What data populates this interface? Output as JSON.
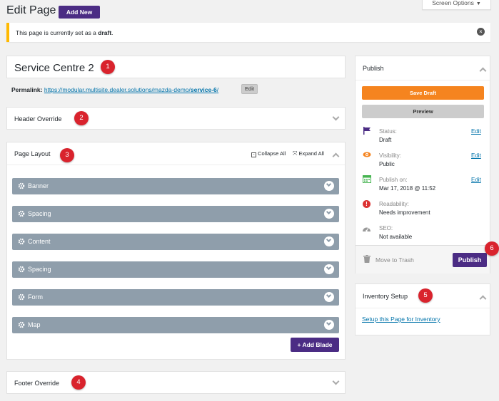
{
  "header": {
    "title": "Edit Page",
    "add_new": "Add New",
    "screen_options": "Screen Options"
  },
  "notice": {
    "text_prefix": "This page is currently set as a ",
    "status": "draft",
    "text_suffix": "."
  },
  "post": {
    "title": "Service Centre 2",
    "permalink_label": "Permalink:",
    "permalink_base": "https://modular.multisite.dealer.solutions/mazda-demo/",
    "permalink_slug": "service-6",
    "permalink_trail": "/",
    "permalink_edit": "Edit"
  },
  "panels": {
    "header_override": "Header Override",
    "page_layout": "Page Layout",
    "collapse_all": "Collapse All",
    "expand_all": "Expand All",
    "footer_override": "Footer Override"
  },
  "blades": [
    {
      "label": "Banner"
    },
    {
      "label": "Spacing"
    },
    {
      "label": "Content"
    },
    {
      "label": "Spacing"
    },
    {
      "label": "Form"
    },
    {
      "label": "Map"
    }
  ],
  "add_blade": "+ Add Blade",
  "publish": {
    "title": "Publish",
    "save_draft": "Save Draft",
    "preview": "Preview",
    "status_label": "Status:",
    "status_value": "Draft",
    "visibility_label": "Visibility:",
    "visibility_value": "Public",
    "publish_on_label": "Publish on:",
    "publish_on_value": "Mar 17, 2018 @ 11:52",
    "readability_label": "Readability:",
    "readability_value": "Needs improvement",
    "seo_label": "SEO:",
    "seo_value": "Not available",
    "edit": "Edit",
    "move_to_trash": "Move to Trash",
    "publish_button": "Publish"
  },
  "inventory": {
    "title": "Inventory Setup",
    "link": "Setup this Page for Inventory"
  },
  "markers": [
    "1",
    "2",
    "3",
    "4",
    "5",
    "6"
  ],
  "colors": {
    "purple": "#4b2c84",
    "orange": "#f5841f",
    "marker_red": "#d9232d",
    "blade_gray": "#8f9eab",
    "notice_yellow": "#ffb900"
  }
}
